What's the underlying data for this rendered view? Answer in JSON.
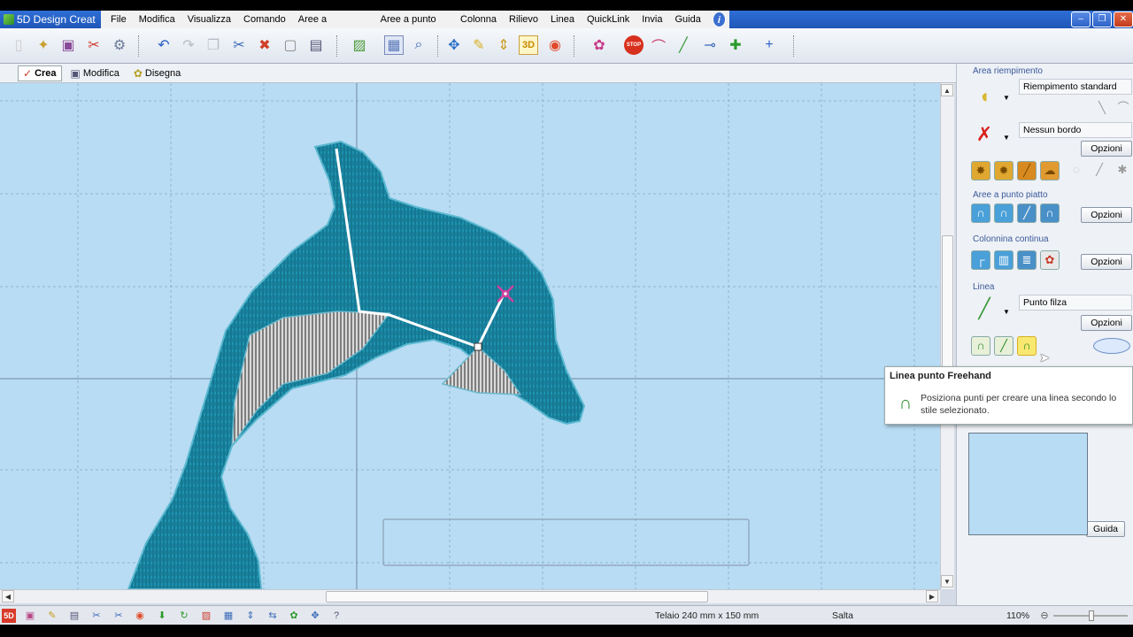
{
  "window": {
    "title": "5D Design Creat",
    "controls": [
      "–",
      "❐",
      "✕"
    ]
  },
  "menu": {
    "items": [
      "File",
      "Modifica",
      "Visualizza",
      "Comando",
      "Aree a riempimento",
      "Aree a punto piatto",
      "Colonna",
      "Rilievo",
      "Linea",
      "QuickLink",
      "Invia",
      "Guida"
    ],
    "help_glyph": "i"
  },
  "toolbar": {
    "icons": [
      "new-file-icon",
      "open-folder-icon",
      "save-icon",
      "cut-icon",
      "settings-icon",
      "undo-icon",
      "redo-icon",
      "copy-icon",
      "scissors-icon",
      "delete-icon",
      "shape-icon",
      "table-icon",
      "image-icon",
      "grid-icon",
      "zoom-icon",
      "move-icon",
      "pencil-icon",
      "resize-icon",
      "3d-icon",
      "color-wheel-icon",
      "palette-icon",
      "stop-icon",
      "arc-icon",
      "line-icon",
      "measure-icon",
      "crosshair-icon",
      "plus-icon"
    ],
    "label_3d": "3D",
    "label_stop": "STOP"
  },
  "mode_tabs": [
    {
      "label": "Crea",
      "icon": "✓"
    },
    {
      "label": "Modifica",
      "icon": "▣"
    },
    {
      "label": "Disegna",
      "icon": "✿"
    }
  ],
  "panel": {
    "fill_section": {
      "label": "Area riempimento",
      "fill_type": "Riempimento standard",
      "border_type": "Nessun bordo",
      "options_label": "Opzioni"
    },
    "satin_section": {
      "label": "Aree a punto piatto",
      "options_label": "Opzioni"
    },
    "column_section": {
      "label": "Colonnina continua",
      "options_label": "Opzioni"
    },
    "line_section": {
      "label": "Linea",
      "line_type": "Punto filza",
      "options_label": "Opzioni"
    },
    "help_label": "Guida"
  },
  "tooltip": {
    "title": "Linea punto Freehand",
    "text": "Posiziona punti per creare una linea secondo lo stile selezionato.",
    "icon": "∩"
  },
  "status": {
    "hoop": "Telaio 240 mm x 150 mm",
    "mode": "Salta",
    "zoom": "110%",
    "app_badge": "5D"
  },
  "colors": {
    "canvas": "#b8dcf3",
    "dolphin": "#1e93b1",
    "belly": "#d8d8d8",
    "accent": "#2f6fd6"
  }
}
